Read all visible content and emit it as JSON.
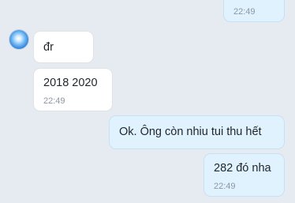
{
  "conversation": {
    "messages": [
      {
        "direction": "out",
        "text": "",
        "time": "22:49"
      },
      {
        "direction": "in",
        "text": "đr",
        "time": ""
      },
      {
        "direction": "in",
        "text": "2018 2020",
        "time": "22:49"
      },
      {
        "direction": "out",
        "text": "Ok. Ông còn nhiu tui thu hết",
        "time": ""
      },
      {
        "direction": "out",
        "text": "282 đó nha",
        "time": "22:49"
      }
    ]
  }
}
